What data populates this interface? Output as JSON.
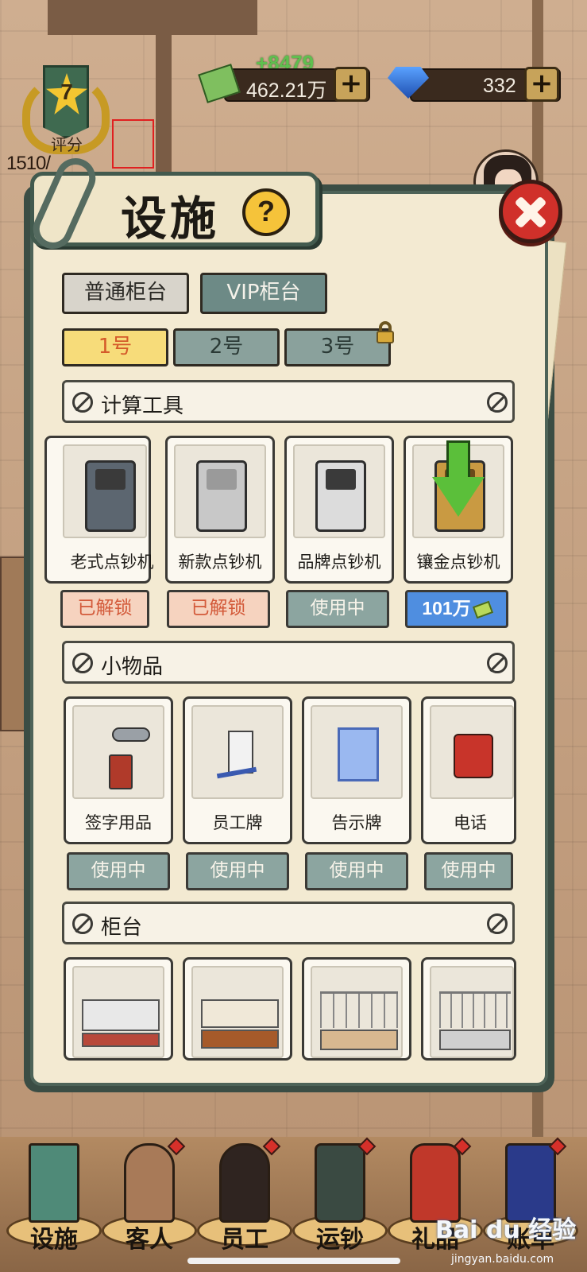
{
  "hud": {
    "rating_level": "7",
    "rating_label": "评分",
    "rating_progress": "1510/",
    "money_gain": "+8479",
    "money": "462.21万",
    "gems": "332",
    "plus": "+"
  },
  "panel": {
    "title": "设施",
    "help": "?",
    "tabs": {
      "normal": "普通柜台",
      "vip": "VIP柜台"
    },
    "counter_tabs": [
      "1号",
      "2号",
      "3号"
    ],
    "sections": {
      "tools": {
        "title": "计算工具",
        "items": [
          {
            "name": "老式点钞机",
            "status": "已解锁",
            "status_type": "unlocked"
          },
          {
            "name": "新款点钞机",
            "status": "已解锁",
            "status_type": "unlocked"
          },
          {
            "name": "品牌点钞机",
            "status": "使用中",
            "status_type": "inuse"
          },
          {
            "name": "镶金点钞机",
            "status": "101万",
            "status_type": "price"
          }
        ]
      },
      "small": {
        "title": "小物品",
        "items": [
          {
            "name": "签字用品",
            "status": "使用中"
          },
          {
            "name": "员工牌",
            "status": "使用中"
          },
          {
            "name": "告示牌",
            "status": "使用中"
          },
          {
            "name": "电话",
            "status": "使用中"
          }
        ]
      },
      "counter": {
        "title": "柜台"
      }
    }
  },
  "bottom_nav": [
    "设施",
    "客人",
    "员工",
    "运钞",
    "礼品",
    "账单"
  ],
  "watermark": {
    "text": "Bai du 经验",
    "sub": "jingyan.baidu.com"
  },
  "colors": {
    "panel_bg": "#f3ead2",
    "panel_border": "#4d6358",
    "status_inuse": "#8ca5a0",
    "status_unlocked": "#f6d3bf",
    "status_price": "#4f8ee0",
    "close_button": "#d0302a",
    "help_button": "#f5c33a"
  }
}
